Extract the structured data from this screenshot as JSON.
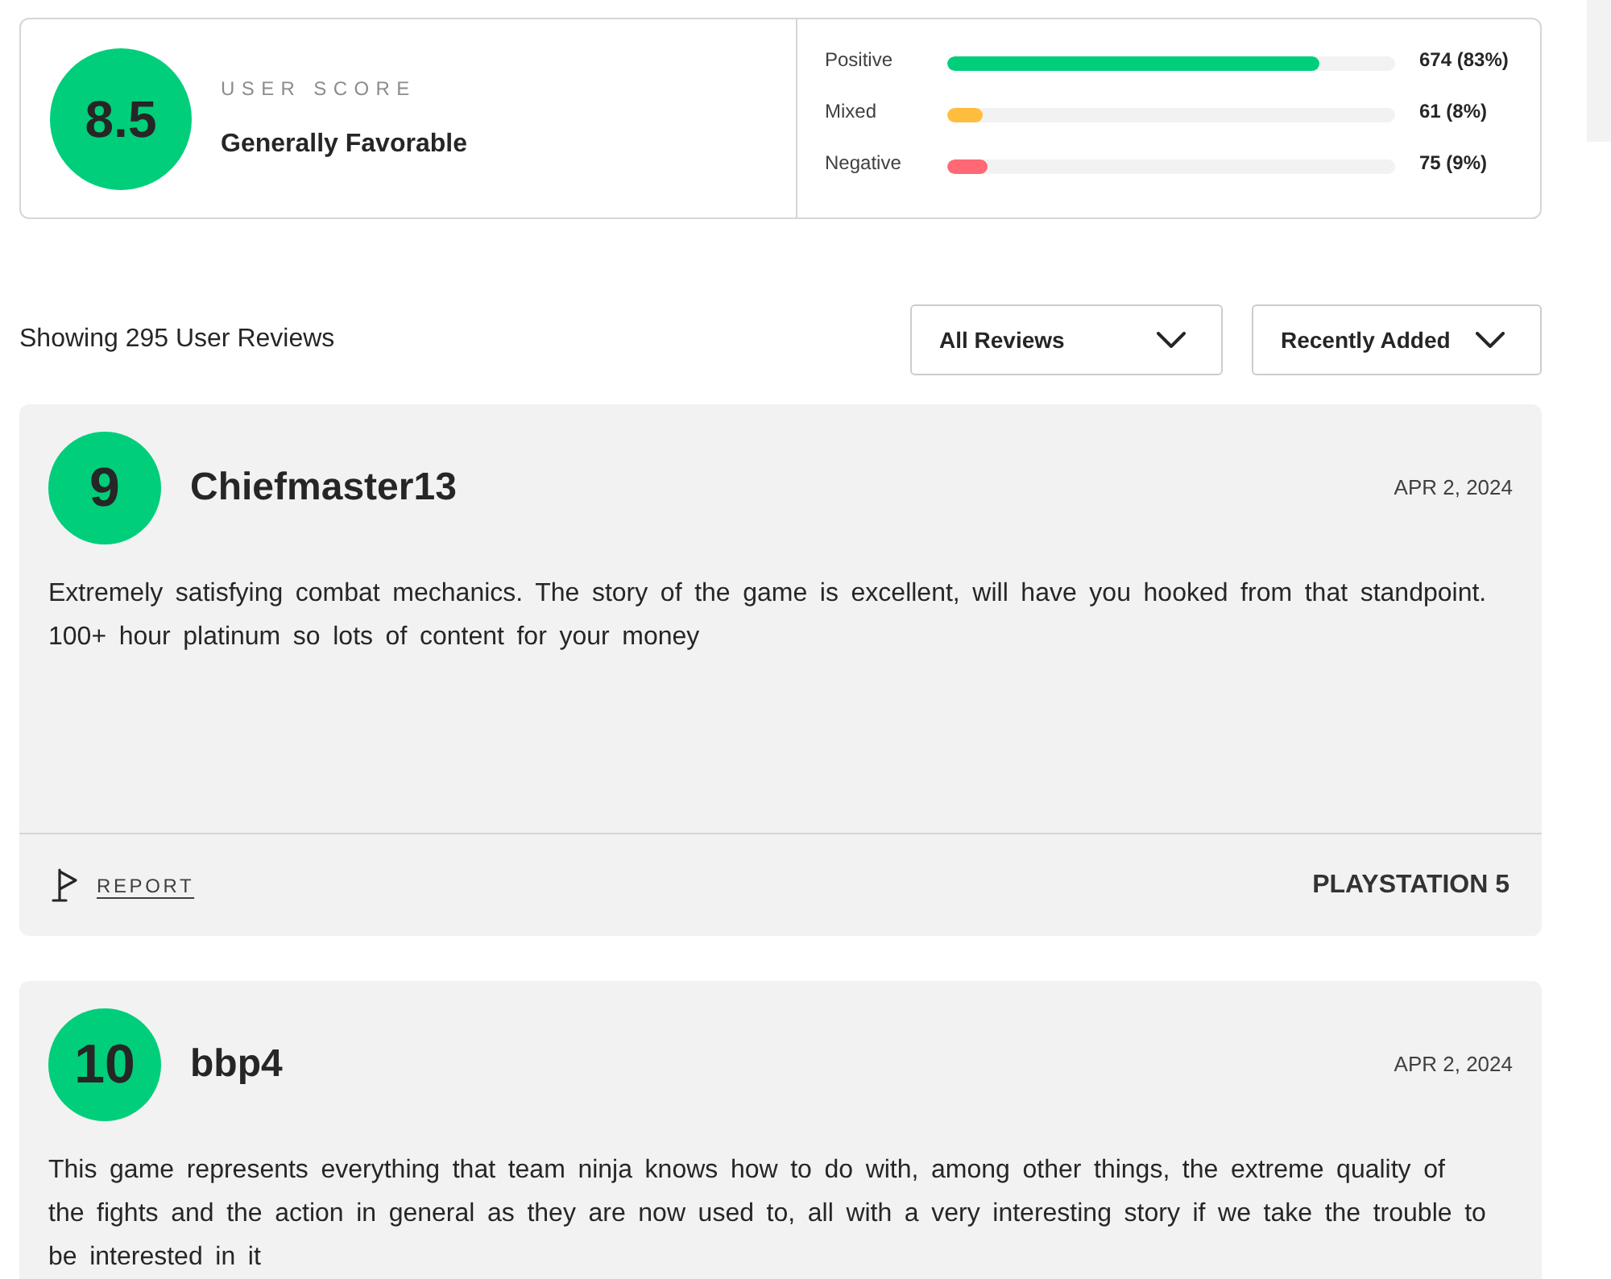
{
  "score_summary": {
    "score": "8.5",
    "label": "USER SCORE",
    "verdict": "Generally Favorable"
  },
  "breakdown": [
    {
      "name": "Positive",
      "level": 0.83,
      "reading": "674 (83%)",
      "color": "#00ce7a"
    },
    {
      "name": "Mixed",
      "level": 0.08,
      "reading": "61 (8%)",
      "color": "#ffbd3f"
    },
    {
      "name": "Negative",
      "level": 0.09,
      "reading": "75 (9%)",
      "color": "#ff6874"
    }
  ],
  "reviews_header": {
    "count_text": "Showing 295 User Reviews",
    "filters": [
      {
        "label": "All Reviews"
      },
      {
        "label": "Recently Added"
      }
    ]
  },
  "reviews": [
    {
      "score": "9",
      "author": "Chiefmaster13",
      "date": "APR 2, 2024",
      "text": "Extremely satisfying combat mechanics. The story of the game is excellent, will have you hooked from that standpoint. 100+ hour platinum so lots of content for your money",
      "report": "REPORT",
      "platform": "PLAYSTATION 5"
    },
    {
      "score": "10",
      "author": "bbp4",
      "date": "APR 2, 2024",
      "text": "This game represents everything that team ninja knows how to do with, among other things, the extreme quality of the fights and the action in general as they are now used to, all with a very interesting story if we take the trouble to be interested in it"
    }
  ]
}
